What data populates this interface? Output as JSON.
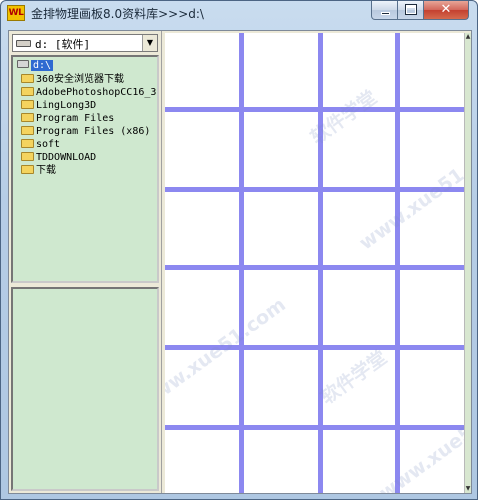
{
  "window": {
    "title": "金排物理画板8.0资料库>>>d:\\",
    "app_icon_text": "WL"
  },
  "caption_buttons": {
    "close_glyph": "✕"
  },
  "drive_selector": {
    "value": "d: [软件]"
  },
  "folder_tree": {
    "root": "d:\\",
    "items": [
      "360安全浏览器下载",
      "AdobePhotoshopCC16_3",
      "LingLong3D",
      "Program Files",
      "Program Files (x86)",
      "soft",
      "TDDOWNLOAD",
      "下载"
    ]
  },
  "watermark": {
    "line1": "软件学堂",
    "line2": "www.xue51.com"
  },
  "colors": {
    "grid_line": "#8c88f0",
    "tree_bg": "#cfe8cf",
    "selection": "#2f6ad1"
  }
}
